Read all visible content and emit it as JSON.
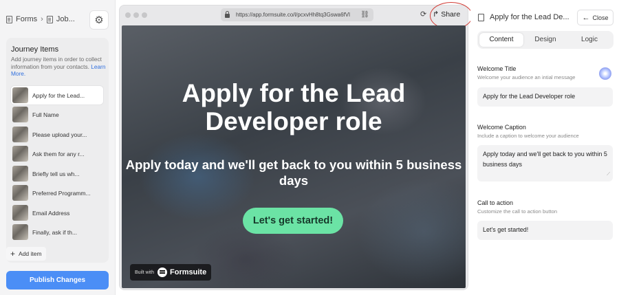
{
  "left_panel": {
    "breadcrumb": {
      "root": "Forms",
      "current": "Job..."
    },
    "journey": {
      "title": "Journey Items",
      "description": "Add journey items in order to collect information from your contacts.",
      "learn_more": "Learn More.",
      "items": [
        {
          "label": "Apply for the Lead..."
        },
        {
          "label": "Full Name"
        },
        {
          "label": "Please upload your..."
        },
        {
          "label": "Ask them for any r..."
        },
        {
          "label": "Briefly tell us wh..."
        },
        {
          "label": "Preferred Programm..."
        },
        {
          "label": "Email Address"
        },
        {
          "label": "Finally, ask if th..."
        }
      ],
      "add_item": "Add item"
    },
    "publish_label": "Publish Changes"
  },
  "browser": {
    "url": "https://app.formsuite.co/l/pcxvHh8tq3Gswa6fVl",
    "share_label": "Share"
  },
  "preview": {
    "title": "Apply for the Lead Developer role",
    "subtitle": "Apply today and we'll get back to you within 5 business days",
    "cta": "Let's get started!",
    "built_with": "Built with",
    "brand": "Formsuite"
  },
  "right_panel": {
    "header_title": "Apply for the Lead De...",
    "close_label": "Close",
    "tabs": [
      {
        "label": "Content"
      },
      {
        "label": "Design"
      },
      {
        "label": "Logic"
      }
    ],
    "active_tab": "Content",
    "fields": {
      "welcome_title": {
        "label": "Welcome Title",
        "help": "Welcome your audience an intial message",
        "value": "Apply for the Lead Developer role"
      },
      "welcome_caption": {
        "label": "Welcome Caption",
        "help": "Include a caption to welcome your audience",
        "value": "Apply today and we'll get back to you within 5 business days"
      },
      "call_to_action": {
        "label": "Call to action",
        "help": "Customize the call to action button",
        "value": "Let's get started!"
      }
    }
  },
  "colors": {
    "publish": "#4b8ef6",
    "cta": "#6be3a5",
    "link": "#2f6fde",
    "annotation": "#d23b34"
  }
}
